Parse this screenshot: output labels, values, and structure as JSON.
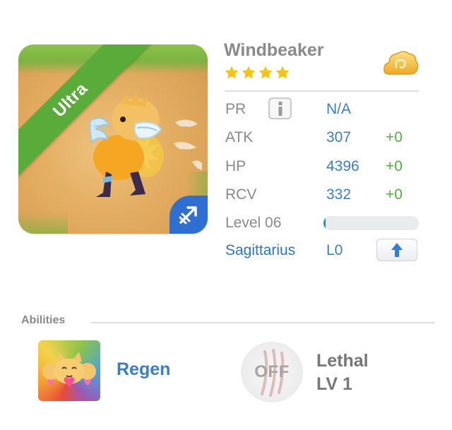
{
  "creature": {
    "name": "Windbeaker",
    "stars": 4,
    "rarity_label": "Ultra",
    "element_icon": "cloud-icon",
    "zodiac_icon": "sagittarius-arrow-icon"
  },
  "stats": {
    "pr_label": "PR",
    "pr_value": "N/A",
    "atk_label": "ATK",
    "atk_value": "307",
    "atk_bonus": "+0",
    "hp_label": "HP",
    "hp_value": "4396",
    "hp_bonus": "+0",
    "rcv_label": "RCV",
    "rcv_value": "332",
    "rcv_bonus": "+0",
    "level_label": "Level 06",
    "level_progress": 0.02,
    "sign_label": "Sagittarius",
    "sign_level": "L0"
  },
  "abilities": {
    "section_title": "Abilities",
    "items": [
      {
        "name": "Regen",
        "icon": "regen-cats-icon"
      },
      {
        "badge": "OFF",
        "name": "Lethal",
        "level": "LV 1",
        "icon": "claw-scratch-icon"
      }
    ]
  },
  "colors": {
    "accent_blue": "#3a7fc6",
    "bonus_green": "#52b043",
    "ribbon_green": "#5aac3a",
    "badge_blue": "#2f6fd1",
    "star_yellow": "#f7c313"
  }
}
